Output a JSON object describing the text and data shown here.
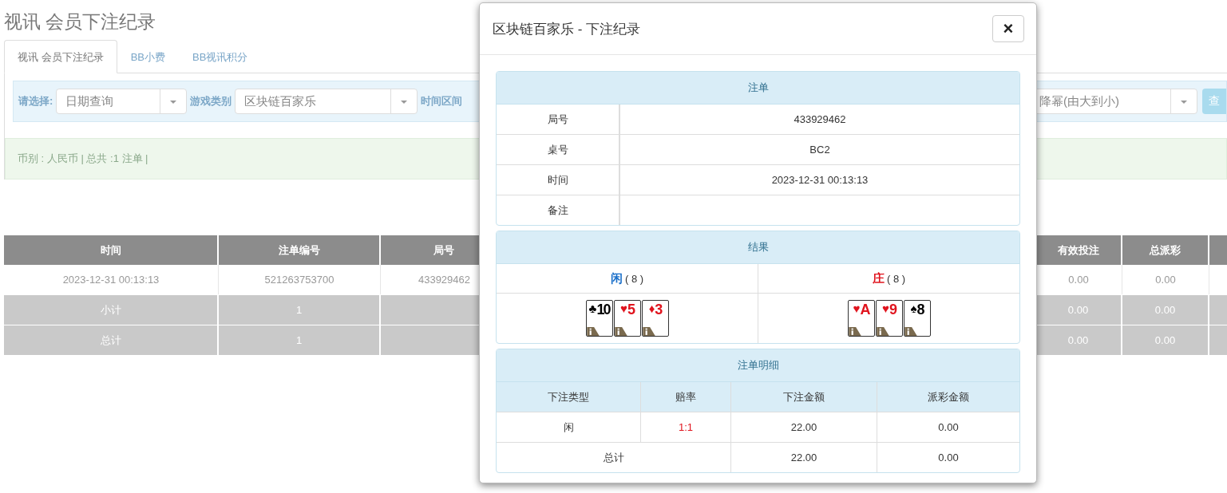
{
  "page_title": "视讯 会员下注纪录",
  "tabs": [
    {
      "label": "视讯 会员下注纪录",
      "selected": true
    },
    {
      "label": "BB小费",
      "selected": false
    },
    {
      "label": "BB视讯积分",
      "selected": false
    }
  ],
  "filter": {
    "prompt": "请选择:",
    "date_mode": "日期查询",
    "game_label": "游戏类别",
    "game": "区块链百家乐",
    "range_label": "时间区间",
    "order": "降幂(由大到小)",
    "button": "查"
  },
  "summary": "币别 : 人民币 | 总共 :1 注单 |",
  "table": {
    "columns": [
      "时间",
      "注单编号",
      "局号",
      "有效投注",
      "总派彩"
    ],
    "rows": [
      {
        "kind": "data",
        "cells": [
          "2023-12-31 00:13:13",
          "521263753700",
          "433929462",
          "0.00",
          "0.00"
        ]
      },
      {
        "kind": "total",
        "cells": [
          "小计",
          "1",
          "",
          "0.00",
          "0.00"
        ]
      },
      {
        "kind": "total",
        "cells": [
          "总计",
          "1",
          "",
          "0.00",
          "0.00"
        ]
      }
    ]
  },
  "modal": {
    "title": "区块链百家乐 - 下注纪录",
    "close": "×",
    "ticket": {
      "heading": "注单",
      "fields": [
        {
          "label": "局号",
          "value": "433929462"
        },
        {
          "label": "桌号",
          "value": "BC2"
        },
        {
          "label": "时间",
          "value": "2023-12-31 00:13:13"
        },
        {
          "label": "备注"
        }
      ]
    },
    "result": {
      "heading": "结果",
      "sides": [
        {
          "name": "闲",
          "score": "( 8 )",
          "color": "#1a6fc9",
          "cards": [
            {
              "rank": "10",
              "suit": "♣",
              "color": "#000000"
            },
            {
              "rank": "5",
              "suit": "♥",
              "color": "#e0141e"
            },
            {
              "rank": "3",
              "suit": "♦",
              "color": "#e0141e"
            }
          ]
        },
        {
          "name": "庄",
          "score": "( 8 )",
          "color": "#e0141e",
          "cards": [
            {
              "rank": "A",
              "suit": "♥",
              "color": "#e0141e"
            },
            {
              "rank": "9",
              "suit": "♥",
              "color": "#e0141e"
            },
            {
              "rank": "8",
              "suit": "♠",
              "color": "#000000"
            }
          ]
        }
      ]
    },
    "details": {
      "heading": "注单明细",
      "columns": [
        "下注类型",
        "赔率",
        "下注金额",
        "派彩金额"
      ],
      "rows": [
        {
          "type": "闲",
          "odds": "1:1",
          "amount": "22.00",
          "payout": "0.00"
        }
      ],
      "total": {
        "label": "总计",
        "amount": "22.00",
        "payout": "0.00"
      }
    }
  }
}
